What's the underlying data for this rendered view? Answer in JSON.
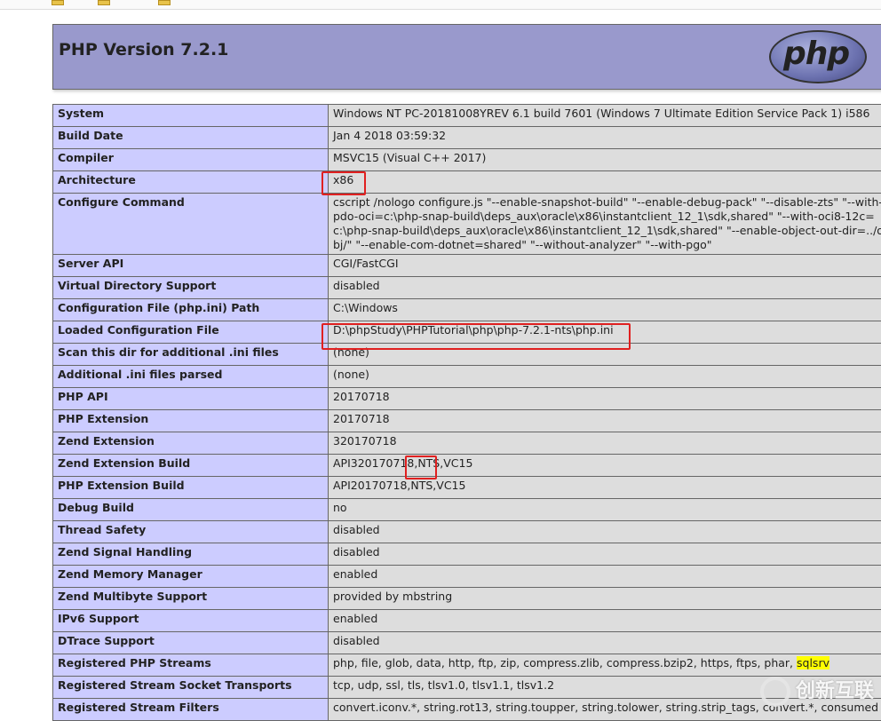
{
  "header": {
    "title": "PHP Version 7.2.1",
    "logo_text": "php"
  },
  "rows": [
    {
      "label": "System",
      "value": "Windows NT PC-20181008YREV 6.1 build 7601 (Windows 7 Ultimate Edition Service Pack 1) i586"
    },
    {
      "label": "Build Date",
      "value": "Jan 4 2018 03:59:32"
    },
    {
      "label": "Compiler",
      "value": "MSVC15 (Visual C++ 2017)"
    },
    {
      "label": "Architecture",
      "value": "x86"
    },
    {
      "label": "Configure Command",
      "value": "cscript /nologo configure.js \"--enable-snapshot-build\" \"--enable-debug-pack\" \"--disable-zts\" \"--with-pdo-oci=c:\\php-snap-build\\deps_aux\\oracle\\x86\\instantclient_12_1\\sdk,shared\" \"--with-oci8-12c=c:\\php-snap-build\\deps_aux\\oracle\\x86\\instantclient_12_1\\sdk,shared\" \"--enable-object-out-dir=../obj/\" \"--enable-com-dotnet=shared\" \"--without-analyzer\" \"--with-pgo\""
    },
    {
      "label": "Server API",
      "value": "CGI/FastCGI"
    },
    {
      "label": "Virtual Directory Support",
      "value": "disabled"
    },
    {
      "label": "Configuration File (php.ini) Path",
      "value": "C:\\Windows"
    },
    {
      "label": "Loaded Configuration File",
      "value": "D:\\phpStudy\\PHPTutorial\\php\\php-7.2.1-nts\\php.ini"
    },
    {
      "label": "Scan this dir for additional .ini files",
      "value": "(none)"
    },
    {
      "label": "Additional .ini files parsed",
      "value": "(none)"
    },
    {
      "label": "PHP API",
      "value": "20170718"
    },
    {
      "label": "PHP Extension",
      "value": "20170718"
    },
    {
      "label": "Zend Extension",
      "value": "320170718"
    },
    {
      "label": "Zend Extension Build",
      "value": "API320170718,NTS,VC15"
    },
    {
      "label": "PHP Extension Build",
      "value": "API20170718,NTS,VC15"
    },
    {
      "label": "Debug Build",
      "value": "no"
    },
    {
      "label": "Thread Safety",
      "value": "disabled"
    },
    {
      "label": "Zend Signal Handling",
      "value": "disabled"
    },
    {
      "label": "Zend Memory Manager",
      "value": "enabled"
    },
    {
      "label": "Zend Multibyte Support",
      "value": "provided by mbstring"
    },
    {
      "label": "IPv6 Support",
      "value": "enabled"
    },
    {
      "label": "DTrace Support",
      "value": "disabled"
    },
    {
      "label": "Registered PHP Streams",
      "value": "php, file, glob, data, http, ftp, zip, compress.zlib, compress.bzip2, https, ftps, phar, ",
      "highlight": "sqlsrv"
    },
    {
      "label": "Registered Stream Socket Transports",
      "value": "tcp, udp, ssl, tls, tlsv1.0, tlsv1.1, tlsv1.2"
    },
    {
      "label": "Registered Stream Filters",
      "value": "convert.iconv.*, string.rot13, string.toupper, string.tolower, string.strip_tags, convert.*, consumed"
    }
  ],
  "watermark": "创新互联",
  "colors": {
    "header": "#9999cc",
    "label_cell": "#ccccff",
    "value_cell": "#dddddd",
    "annotation": "#e02020",
    "highlight": "#ffff00"
  }
}
